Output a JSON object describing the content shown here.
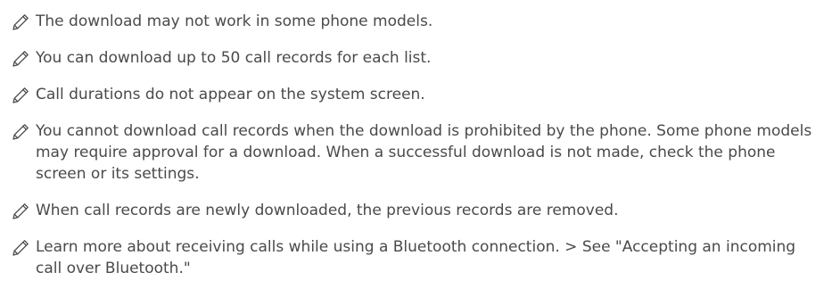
{
  "notes": [
    {
      "icon": "pencil-icon",
      "text": "The download may not work in some phone models."
    },
    {
      "icon": "pencil-icon",
      "text": "You can download up to 50 call records for each list."
    },
    {
      "icon": "pencil-icon",
      "text": "Call durations do not appear on the system screen."
    },
    {
      "icon": "pencil-icon",
      "text": "You cannot download call records when the download is prohibited by the phone. Some phone models may require approval for a download. When a successful download is not made, check the phone screen or its settings."
    },
    {
      "icon": "pencil-icon",
      "text": "When call records are newly downloaded, the previous records are removed."
    },
    {
      "icon": "pencil-icon",
      "text": "Learn more about receiving calls while using a Bluetooth connection. > See \"Accepting an incoming call over Bluetooth.\""
    }
  ]
}
